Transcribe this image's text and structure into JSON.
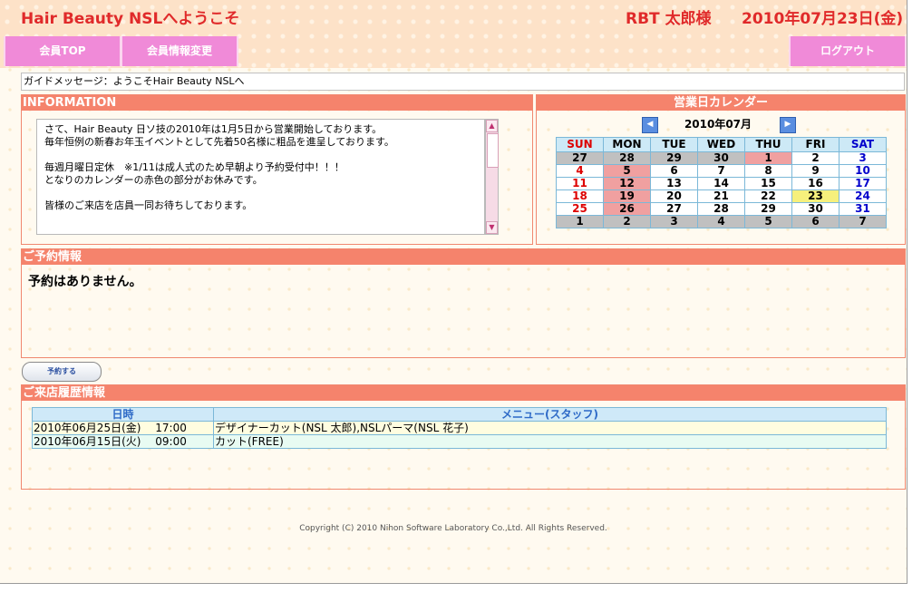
{
  "header": {
    "site_title": "Hair Beauty NSLへようこそ",
    "user_name": "RBT 太郎様",
    "date": "2010年07月23日(金)"
  },
  "nav": {
    "member_top": "会員TOP",
    "member_info_change": "会員情報変更",
    "logout": "ログアウト"
  },
  "guide_message": "ガイドメッセージ：ようこそHair Beauty NSLへ",
  "information": {
    "title": "INFORMATION",
    "lines": [
      "さて、Hair Beauty 日ソ技の2010年は1月5日から営業開始しております。",
      "毎年恒例の新春お年玉イベントとして先着50名様に粗品を進呈しております。",
      "",
      "毎週月曜日定休　※1/11は成人式のため早朝より予約受付中！！！",
      "となりのカレンダーの赤色の部分がお休みです。",
      "",
      "皆様のご来店を店員一同お待ちしております。"
    ]
  },
  "calendar": {
    "title": "営業日カレンダー",
    "month": "2010年07月",
    "weekdays": [
      "SUN",
      "MON",
      "TUE",
      "WED",
      "THU",
      "FRI",
      "SAT"
    ],
    "weeks": [
      [
        {
          "d": "27",
          "s": "other"
        },
        {
          "d": "28",
          "s": "other"
        },
        {
          "d": "29",
          "s": "other"
        },
        {
          "d": "30",
          "s": "other"
        },
        {
          "d": "1",
          "s": "holiday"
        },
        {
          "d": "2",
          "s": ""
        },
        {
          "d": "3",
          "s": "sat"
        }
      ],
      [
        {
          "d": "4",
          "s": "sun"
        },
        {
          "d": "5",
          "s": "holiday"
        },
        {
          "d": "6",
          "s": ""
        },
        {
          "d": "7",
          "s": ""
        },
        {
          "d": "8",
          "s": ""
        },
        {
          "d": "9",
          "s": ""
        },
        {
          "d": "10",
          "s": "sat"
        }
      ],
      [
        {
          "d": "11",
          "s": "sun"
        },
        {
          "d": "12",
          "s": "holiday"
        },
        {
          "d": "13",
          "s": ""
        },
        {
          "d": "14",
          "s": ""
        },
        {
          "d": "15",
          "s": ""
        },
        {
          "d": "16",
          "s": ""
        },
        {
          "d": "17",
          "s": "sat"
        }
      ],
      [
        {
          "d": "18",
          "s": "sun"
        },
        {
          "d": "19",
          "s": "holiday"
        },
        {
          "d": "20",
          "s": ""
        },
        {
          "d": "21",
          "s": ""
        },
        {
          "d": "22",
          "s": ""
        },
        {
          "d": "23",
          "s": "today"
        },
        {
          "d": "24",
          "s": "sat"
        }
      ],
      [
        {
          "d": "25",
          "s": "sun"
        },
        {
          "d": "26",
          "s": "holiday"
        },
        {
          "d": "27",
          "s": ""
        },
        {
          "d": "28",
          "s": ""
        },
        {
          "d": "29",
          "s": ""
        },
        {
          "d": "30",
          "s": ""
        },
        {
          "d": "31",
          "s": "sat"
        }
      ],
      [
        {
          "d": "1",
          "s": "other"
        },
        {
          "d": "2",
          "s": "other"
        },
        {
          "d": "3",
          "s": "other"
        },
        {
          "d": "4",
          "s": "other"
        },
        {
          "d": "5",
          "s": "other"
        },
        {
          "d": "6",
          "s": "other"
        },
        {
          "d": "7",
          "s": "other"
        }
      ]
    ]
  },
  "reservation": {
    "title": "ご予約情報",
    "message": "予約はありません。",
    "button_label": "予約する"
  },
  "history": {
    "title": "ご来店履歴情報",
    "headers": [
      "日時",
      "メニュー(スタッフ)"
    ],
    "rows": [
      {
        "datetime": "2010年06月25日(金)　 17:00",
        "menu": "デザイナーカット(NSL 太郎),NSLパーマ(NSL 花子)"
      },
      {
        "datetime": "2010年06月15日(火)　 09:00",
        "menu": "カット(FREE)"
      }
    ]
  },
  "copyright": "Copyright (C) 2010 Nihon Software Laboratory Co.,Ltd. All Rights Reserved.",
  "colors": {
    "title_red": "#e02a2a",
    "nav_pink": "#f08ad8",
    "section_bar": "#f5836c",
    "holiday": "#f0a0a0",
    "today": "#f6f07c"
  }
}
